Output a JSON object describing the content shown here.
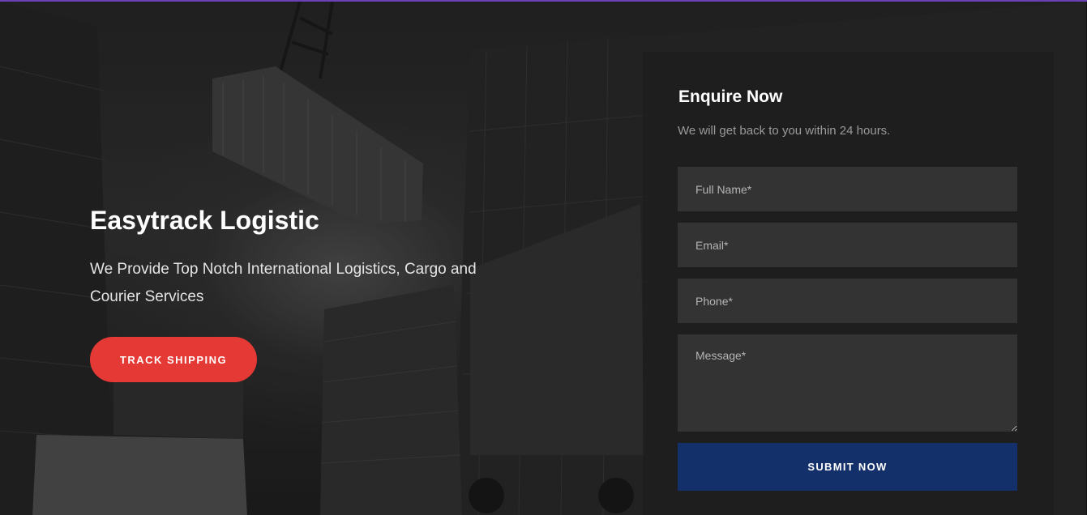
{
  "hero": {
    "title": "Easytrack Logistic",
    "subtitle": "We Provide Top Notch International Logistics, Cargo and Courier Services",
    "cta_label": "TRACK SHIPPING",
    "cta_color": "#e53935",
    "background_image": "shipping-containers-port-photo"
  },
  "enquiry": {
    "title": "Enquire Now",
    "subtitle": "We will get back to you within 24 hours.",
    "full_name": {
      "placeholder": "Full Name*",
      "value": ""
    },
    "email": {
      "placeholder": "Email*",
      "value": ""
    },
    "phone": {
      "placeholder": "Phone*",
      "value": ""
    },
    "message": {
      "placeholder": "Message*",
      "value": ""
    },
    "submit_label": "SUBMIT NOW",
    "submit_color": "#13306b"
  },
  "theme": {
    "top_border_color": "#6b3fb5"
  }
}
